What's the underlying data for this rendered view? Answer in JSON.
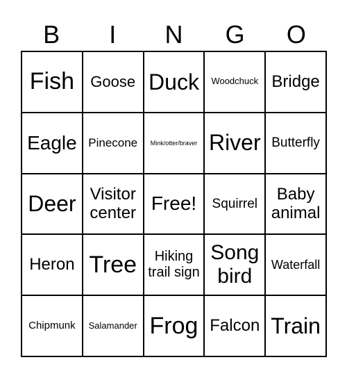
{
  "header": [
    "B",
    "I",
    "N",
    "G",
    "O"
  ],
  "cells": [
    {
      "text": "Fish",
      "size": 34
    },
    {
      "text": "Goose",
      "size": 22
    },
    {
      "text": "Duck",
      "size": 32
    },
    {
      "text": "Woodchuck",
      "size": 13
    },
    {
      "text": "Bridge",
      "size": 24
    },
    {
      "text": "Eagle",
      "size": 28
    },
    {
      "text": "Pinecone",
      "size": 17
    },
    {
      "text": "Mink/otter/braver",
      "size": 9
    },
    {
      "text": "River",
      "size": 32
    },
    {
      "text": "Butterfly",
      "size": 19
    },
    {
      "text": "Deer",
      "size": 32
    },
    {
      "text": "Visitor center",
      "size": 24
    },
    {
      "text": "Free!",
      "size": 28
    },
    {
      "text": "Squirrel",
      "size": 19
    },
    {
      "text": "Baby animal",
      "size": 24
    },
    {
      "text": "Heron",
      "size": 24
    },
    {
      "text": "Tree",
      "size": 34
    },
    {
      "text": "Hiking trail sign",
      "size": 20
    },
    {
      "text": "Song bird",
      "size": 30
    },
    {
      "text": "Waterfall",
      "size": 18
    },
    {
      "text": "Chipmunk",
      "size": 15
    },
    {
      "text": "Salamander",
      "size": 13
    },
    {
      "text": "Frog",
      "size": 34
    },
    {
      "text": "Falcon",
      "size": 24
    },
    {
      "text": "Train",
      "size": 32
    }
  ]
}
